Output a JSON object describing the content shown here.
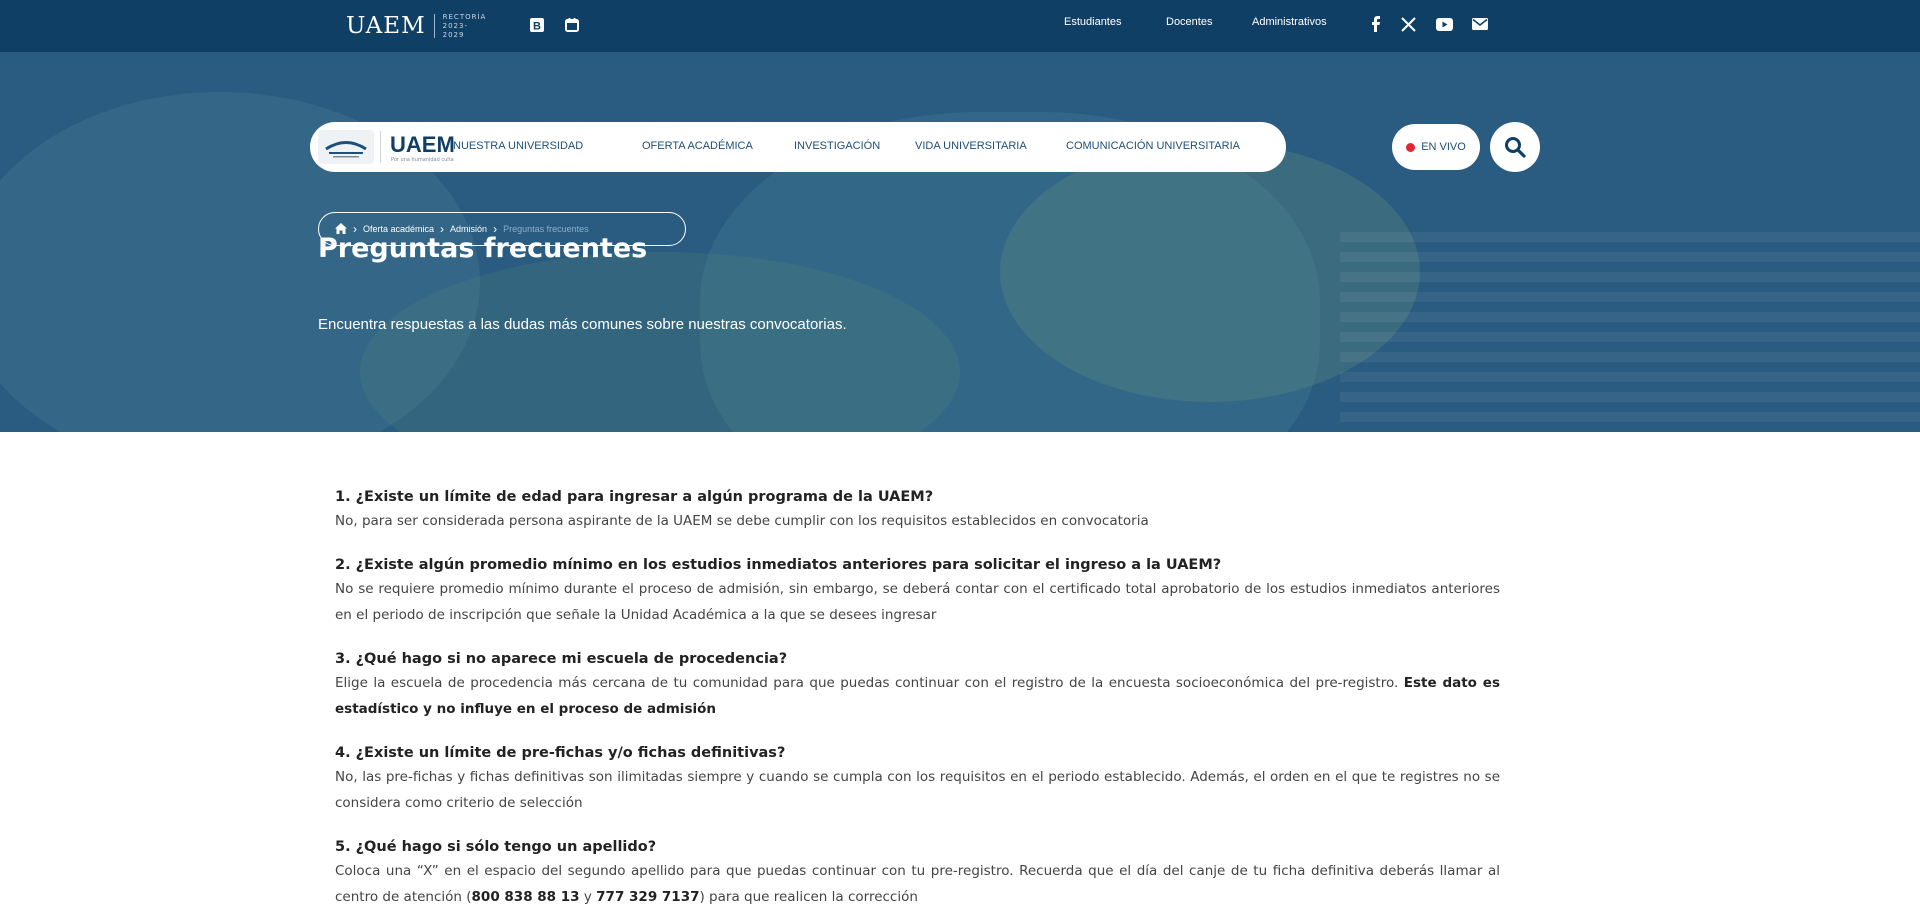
{
  "topbar": {
    "brand_name": "UAEM",
    "brand_sub": "RECTORÍA 2023-2029",
    "links": [
      "Estudiantes",
      "Docentes",
      "Administrativos"
    ],
    "socials": [
      "facebook-icon",
      "x-icon",
      "youtube-icon",
      "mail-icon"
    ]
  },
  "nav": {
    "logo_word": "UAEM",
    "logo_tag": "Por una humanidad culta",
    "menu": [
      "NUESTRA UNIVERSIDAD",
      "OFERTA ACADÉMICA",
      "INVESTIGACIÓN",
      "VIDA UNIVERSITARIA",
      "COMUNICACIÓN UNIVERSITARIA"
    ],
    "live_label": "EN VIVO"
  },
  "breadcrumb": {
    "items": [
      "Oferta académica",
      "Admisión"
    ],
    "current": "Preguntas frecuentes"
  },
  "hero": {
    "title": "Preguntas frecuentes",
    "description": "Encuentra respuestas a las dudas más comunes sobre nuestras convocatorias."
  },
  "faq": [
    {
      "question": "1. ¿Existe un límite de edad para ingresar a algún programa de la UAEM?",
      "answer": "No, para ser considerada persona aspirante de la UAEM se debe cumplir con los requisitos establecidos en convocatoria"
    },
    {
      "question": "2. ¿Existe algún promedio mínimo en los estudios inmediatos anteriores para solicitar el ingreso a la UAEM?",
      "answer": "No se requiere promedio mínimo durante el proceso de admisión, sin embargo, se deberá contar con el certificado total aprobatorio de los estudios inmediatos anteriores en el periodo de inscripción que señale la Unidad Académica a la que se desees ingresar"
    },
    {
      "question": "3. ¿Qué hago si no aparece mi escuela de procedencia?",
      "answer": "Elige la escuela de procedencia más cercana de tu comunidad para que puedas continuar con el registro de la encuesta socioeconómica del pre-registro.",
      "answer_bold": "Este dato es estadístico y no influye en el proceso de admisión"
    },
    {
      "question": "4. ¿Existe un límite de pre-fichas y/o fichas definitivas?",
      "answer": "No, las pre-fichas y fichas definitivas son ilimitadas siempre y cuando se cumpla con los requisitos en el periodo establecido. Además, el orden en el que te registres no se considera como criterio de selección"
    },
    {
      "question": "5. ¿Qué hago si sólo tengo un apellido?",
      "answer_pre": "Coloca una “X” en el espacio del segundo apellido para que puedas continuar con tu pre-registro. Recuerda que el día del canje de tu ficha definitiva deberás llamar al centro de atención (",
      "phone1": "800 838 88 13",
      "answer_mid": " y ",
      "phone2": "777 329 7137",
      "answer_post": ") para que realicen la corrección"
    }
  ]
}
